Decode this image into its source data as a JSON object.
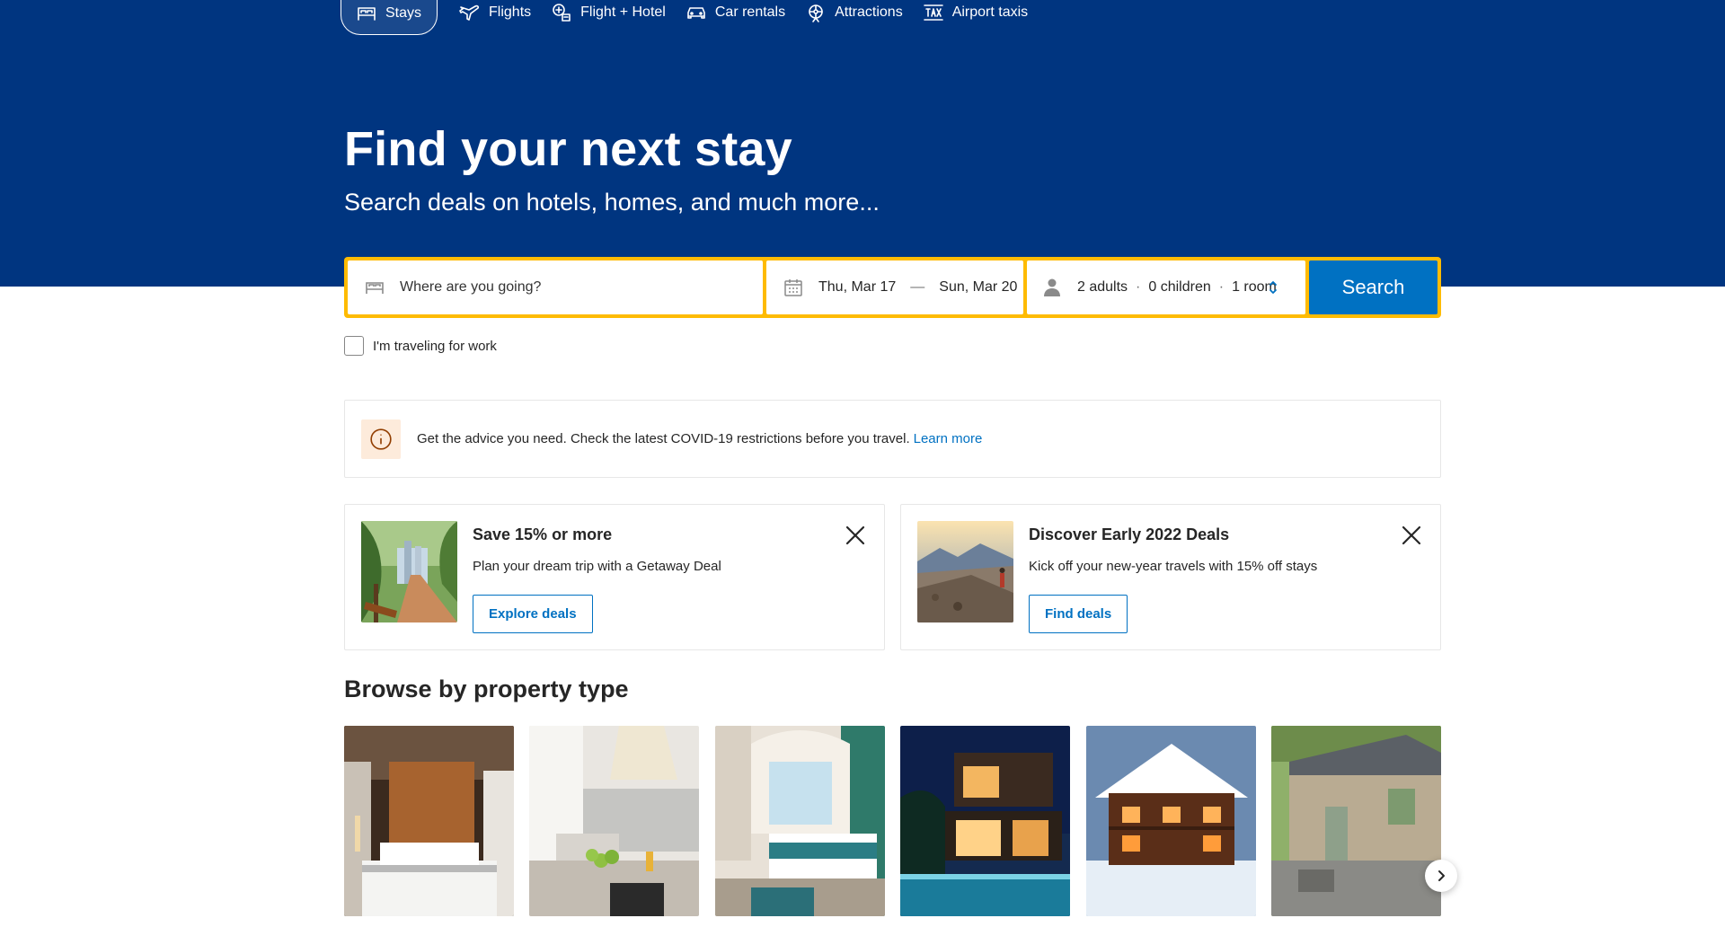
{
  "nav": {
    "items": [
      {
        "label": "Stays",
        "icon": "bed-icon",
        "active": true
      },
      {
        "label": "Flights",
        "icon": "airplane-icon"
      },
      {
        "label": "Flight + Hotel",
        "icon": "flight-hotel-icon"
      },
      {
        "label": "Car rentals",
        "icon": "car-icon"
      },
      {
        "label": "Attractions",
        "icon": "attractions-icon"
      },
      {
        "label": "Airport taxis",
        "icon": "taxi-icon"
      }
    ]
  },
  "hero": {
    "title": "Find your next stay",
    "subtitle": "Search deals on hotels, homes, and much more..."
  },
  "search": {
    "destination_placeholder": "Where are you going?",
    "checkin": "Thu, Mar 17",
    "dash": "—",
    "checkout": "Sun, Mar 20",
    "adults": "2 adults",
    "children": "0 children",
    "rooms": "1 room",
    "separator": "·",
    "button": "Search"
  },
  "work_checkbox": {
    "label": "I'm traveling for work",
    "checked": false
  },
  "notice": {
    "text": "Get the advice you need. Check the latest COVID-19 restrictions before you travel.",
    "link": "Learn more"
  },
  "promos": [
    {
      "title": "Save 15% or more",
      "text": "Plan your dream trip with a Getaway Deal",
      "button": "Explore deals"
    },
    {
      "title": "Discover Early 2022 Deals",
      "text": "Kick off your new-year travels with 15% off stays",
      "button": "Find deals"
    }
  ],
  "browse": {
    "title": "Browse by property type"
  },
  "colors": {
    "brand_blue": "#003580",
    "accent_yellow": "#febb02",
    "action_blue": "#0071c2"
  }
}
